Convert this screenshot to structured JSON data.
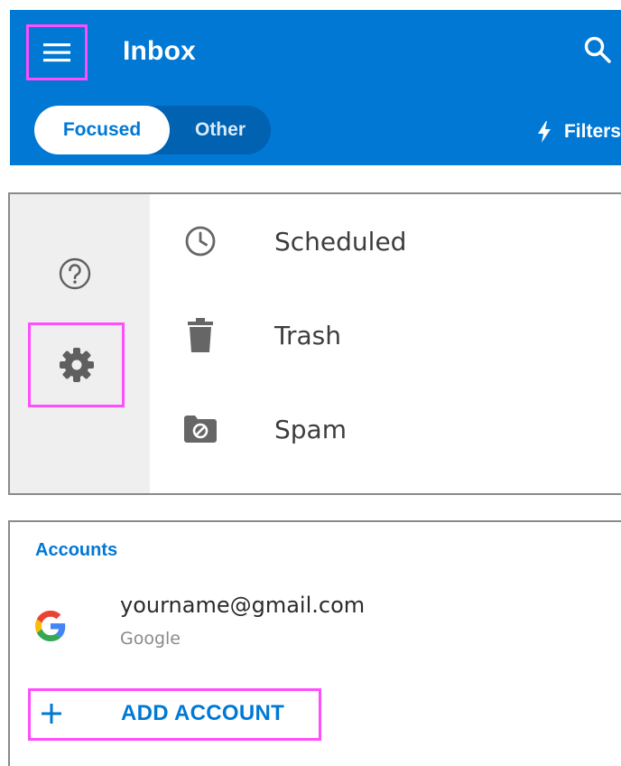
{
  "header": {
    "title": "Inbox",
    "menu_icon": "hamburger-menu-icon",
    "search_icon": "search-icon",
    "tabs": [
      {
        "label": "Focused",
        "selected": true
      },
      {
        "label": "Other",
        "selected": false
      }
    ],
    "filters_label": "Filters",
    "filters_icon": "lightning-bolt-icon",
    "background_color": "#0078d4"
  },
  "rail": {
    "help_icon": "help-circle-icon",
    "settings_icon": "gear-icon"
  },
  "folders": [
    {
      "label": "Scheduled",
      "icon": "clock-icon"
    },
    {
      "label": "Trash",
      "icon": "trash-icon"
    },
    {
      "label": "Spam",
      "icon": "spam-folder-icon"
    }
  ],
  "accounts": {
    "heading": "Accounts",
    "items": [
      {
        "email": "yourname@gmail.com",
        "provider": "Google",
        "icon": "google-icon"
      }
    ],
    "add_account_label": "ADD ACCOUNT",
    "add_icon": "plus-icon"
  },
  "highlight_color": "#ff4dff",
  "accent_color": "#0078d4"
}
